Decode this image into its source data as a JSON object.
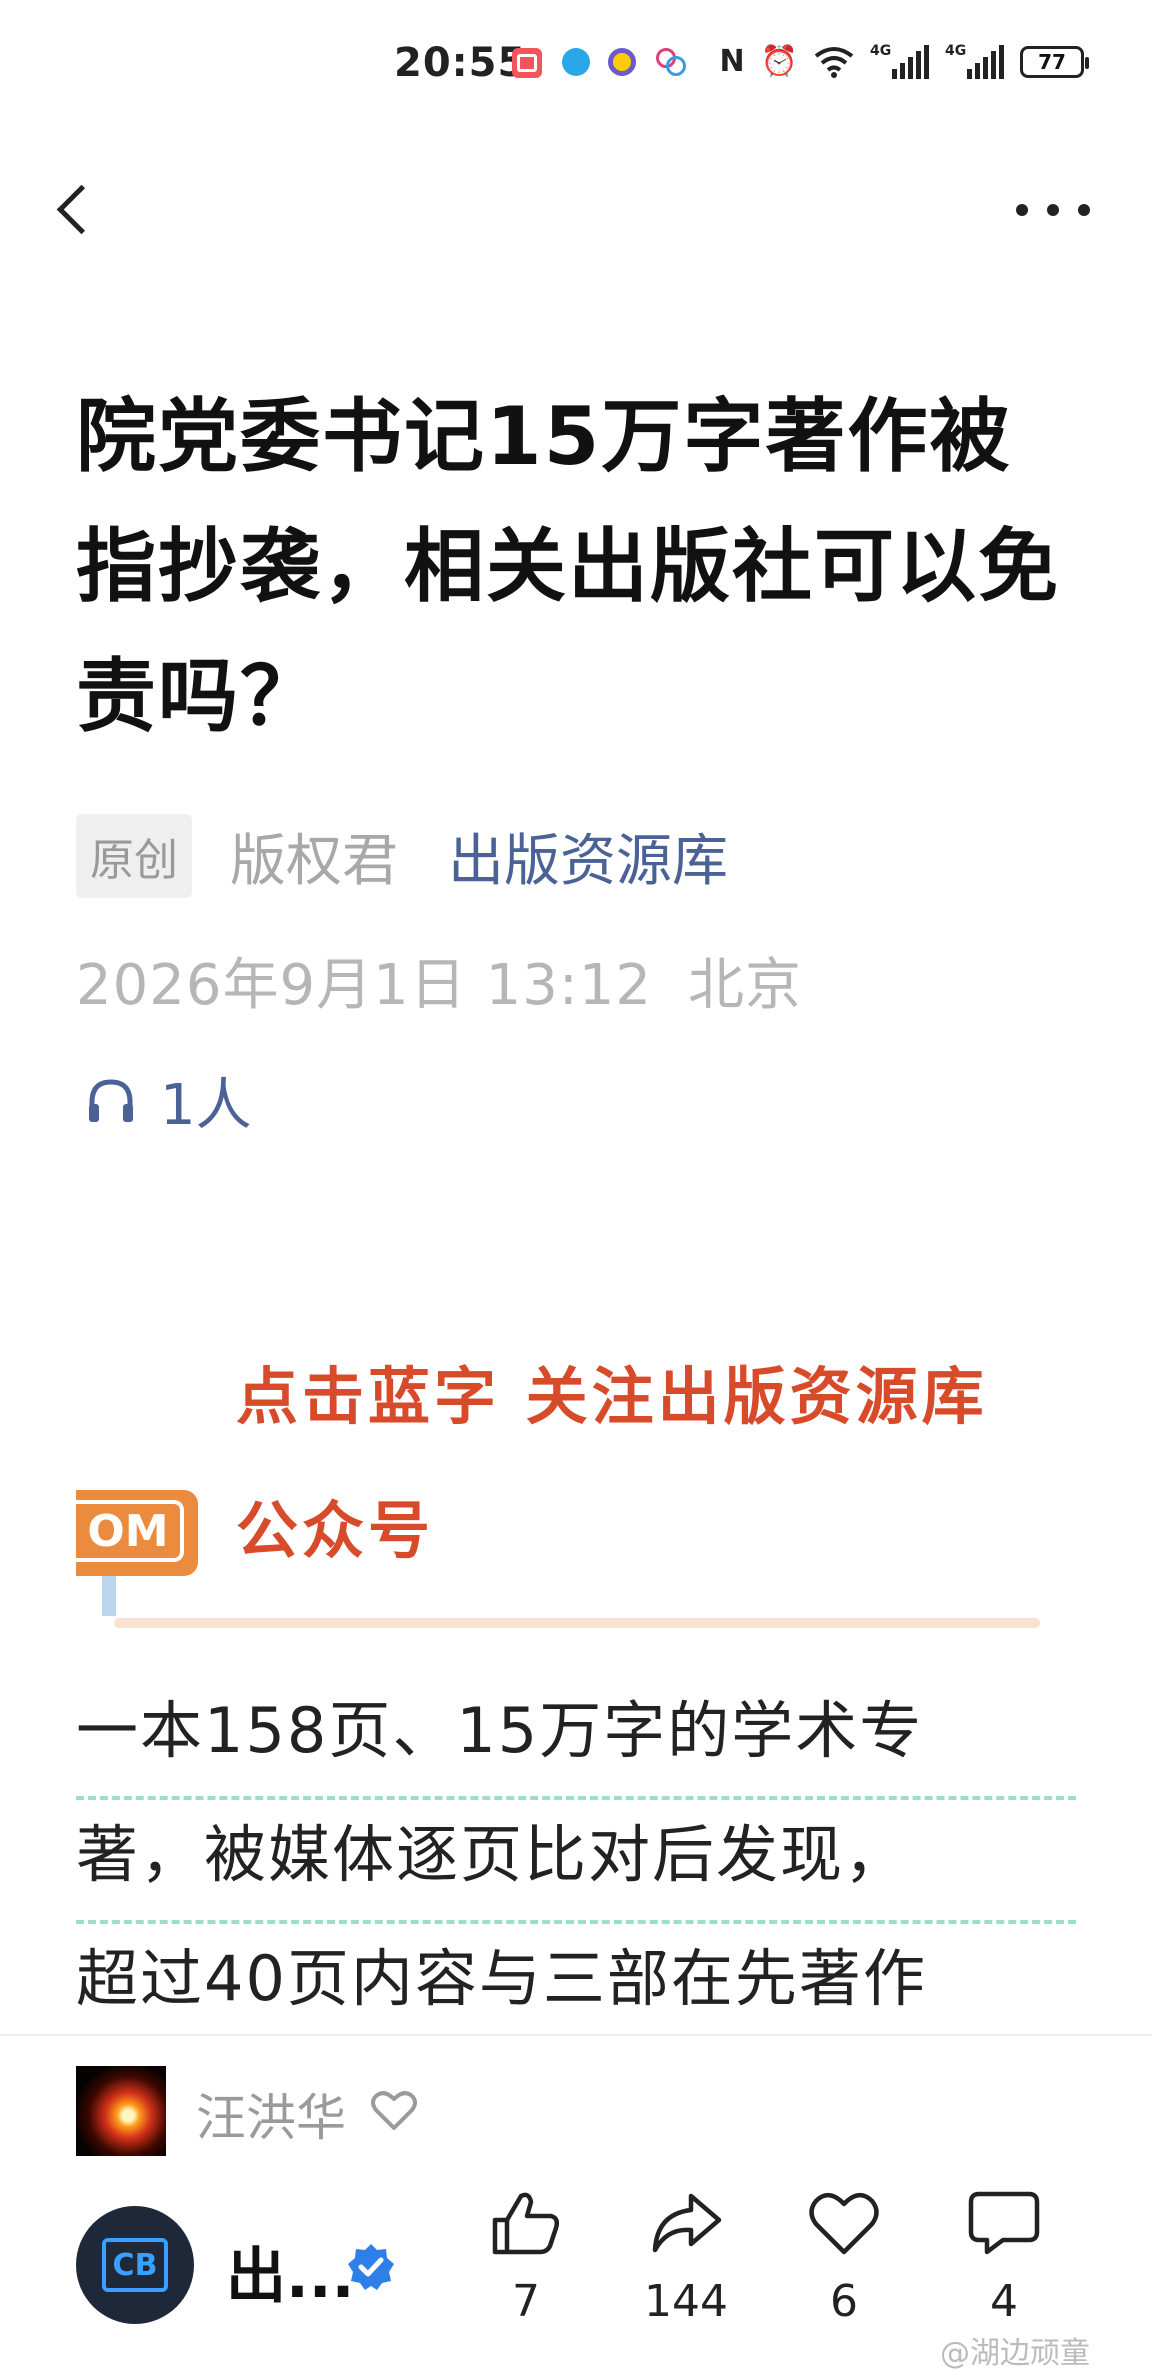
{
  "status_bar": {
    "time": "20:55",
    "signal_tag_1": "4G",
    "signal_tag_2": "4G",
    "battery": "77"
  },
  "article": {
    "title": "院党委书记15万字著作被指抄袭，相关出版社可以免责吗？",
    "original_badge": "原创",
    "author": "版权君",
    "account": "出版资源库",
    "date": "2026年9月1日 13:12",
    "location": "北京",
    "listeners": "1人"
  },
  "banner": {
    "line1": "点击蓝字 关注出版资源库",
    "line2": "公众号",
    "tag": "OM"
  },
  "body": {
    "lines": [
      "一本158页、15万字的学术专",
      "著，被媒体逐页比对后发现，",
      "超过40页内容与三部在先著作"
    ]
  },
  "bottom": {
    "sharer_name": "汪洪华",
    "account_short": "出...",
    "actions": {
      "like_count": "7",
      "share_count": "144",
      "favorite_count": "6",
      "comment_count": "4"
    }
  },
  "watermark": "@湖边顽童",
  "colors": {
    "link_blue": "#4a6296",
    "banner_red": "#d84b2a",
    "banner_orange": "#ea8b3e",
    "dashed_green": "#9be0c3",
    "verified_blue": "#2f7fe8"
  }
}
